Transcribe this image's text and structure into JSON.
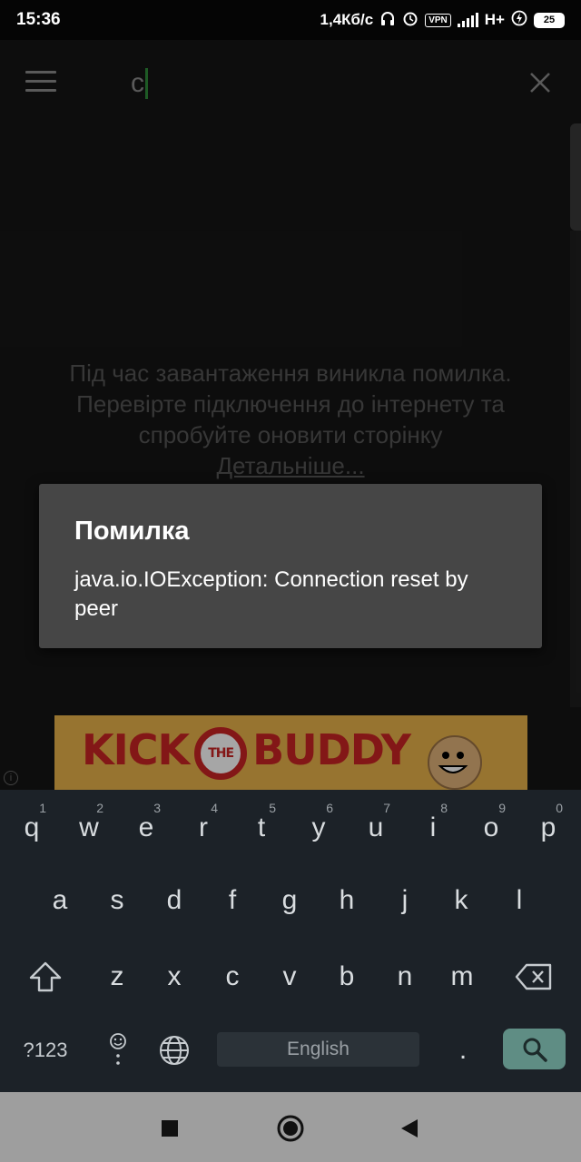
{
  "status_bar": {
    "time": "15:36",
    "speed": "1,4Кб/с",
    "vpn": "VPN",
    "network": "H+",
    "battery": "25"
  },
  "app_bar": {
    "search_value": "c",
    "menu_icon": "hamburger-icon",
    "close_icon": "close-icon"
  },
  "content": {
    "error_lines": [
      "Під час завантаження виникла помилка.",
      "Перевірте підключення до інтернету та",
      "спробуйте оновити сторінку"
    ],
    "details_link": "Детальніше..."
  },
  "dialog": {
    "title": "Помилка",
    "message": "java.io.IOException: Connection reset by peer"
  },
  "ad": {
    "kick": "KICK",
    "the": "THE",
    "buddy": "BUDDY"
  },
  "keyboard": {
    "row1": [
      {
        "key": "q",
        "hint": "1"
      },
      {
        "key": "w",
        "hint": "2"
      },
      {
        "key": "e",
        "hint": "3"
      },
      {
        "key": "r",
        "hint": "4"
      },
      {
        "key": "t",
        "hint": "5"
      },
      {
        "key": "y",
        "hint": "6"
      },
      {
        "key": "u",
        "hint": "7"
      },
      {
        "key": "i",
        "hint": "8"
      },
      {
        "key": "o",
        "hint": "9"
      },
      {
        "key": "p",
        "hint": "0"
      }
    ],
    "row2": [
      "a",
      "s",
      "d",
      "f",
      "g",
      "h",
      "j",
      "k",
      "l"
    ],
    "row3": [
      "z",
      "x",
      "c",
      "v",
      "b",
      "n",
      "m"
    ],
    "symbols_label": "?123",
    "space_label": "English",
    "period_label": "."
  },
  "colors": {
    "accent": "#5f8d84",
    "cursor": "#2e8b3a"
  }
}
